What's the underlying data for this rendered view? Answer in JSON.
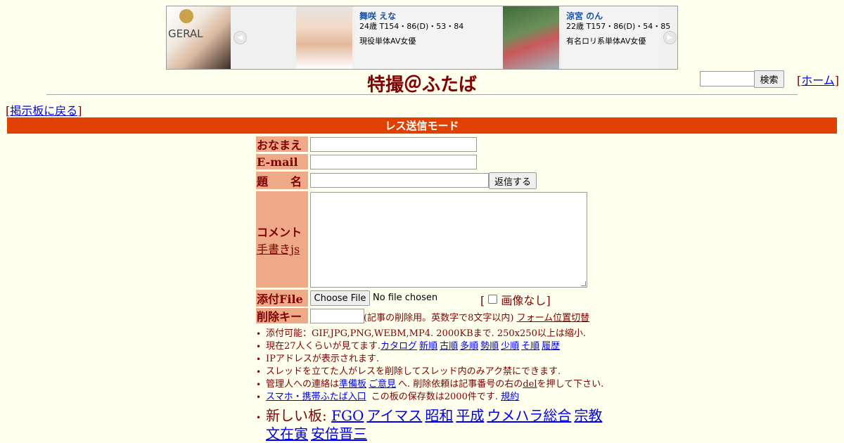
{
  "ads": [
    {
      "name": "舞咲 えな",
      "stats": "24歳 T154・86(D)・53・84",
      "desc": "現役単体AV女優"
    },
    {
      "name": "涼宮 のん",
      "stats": "22歳 T157・86(D)・54・85",
      "desc": "有名ロリ系単体AV女優"
    }
  ],
  "ad_logo_text": "GERAL",
  "header": {
    "title": "特撮＠ふたば",
    "search_button": "検索",
    "home_link": "ホーム"
  },
  "nav": {
    "back_link": "掲示板に戻る"
  },
  "mode_label": "レス送信モード",
  "form": {
    "name_label": "おなまえ",
    "email_label": "E-mail",
    "subject_label": "題　　名",
    "submit_button": "返信する",
    "comment_label": "コメント",
    "handwrite_link": "手書きjs",
    "file_label": "添付File",
    "file_button": "Choose File",
    "file_status": "No file chosen",
    "no_image_label": "画像なし",
    "delkey_label": "削除キー",
    "delkey_note": "(記事の削除用。英数字で8文字以内)",
    "form_toggle_link": "フォーム位置切替"
  },
  "notes": {
    "attach": "添付可能：GIF,JPG,PNG,WEBM,MP4. 2000KBまで. 250x250以上は縮小.",
    "viewers_prefix": "現在27人くらいが見てます.",
    "sort_links": [
      "カタログ",
      "新順",
      "古順",
      "多順",
      "勢順",
      "少順",
      "そ順",
      "履歴"
    ],
    "ip": "IPアドレスが表示されます.",
    "thread_owner": "スレッドを立てた人がレスを削除してスレッド内のみアク禁にできます.",
    "contact_prefix": "管理人への連絡は",
    "contact_link1": "準備板",
    "contact_link2": "ご意見",
    "contact_mid": "へ. 削除依頼は記事番号の右の",
    "del_text": "del",
    "contact_suffix": "を押して下さい.",
    "mobile_link": "スマホ・携帯ふたば入口",
    "retention": " この板の保存数は2000件です.",
    "rules_link": "規約",
    "new_boards_label": "新しい板:",
    "new_boards": [
      "FGO",
      "アイマス",
      "昭和",
      "平成",
      "ウメハラ総合",
      "宗教",
      "文在寅",
      "安倍晋三"
    ]
  }
}
